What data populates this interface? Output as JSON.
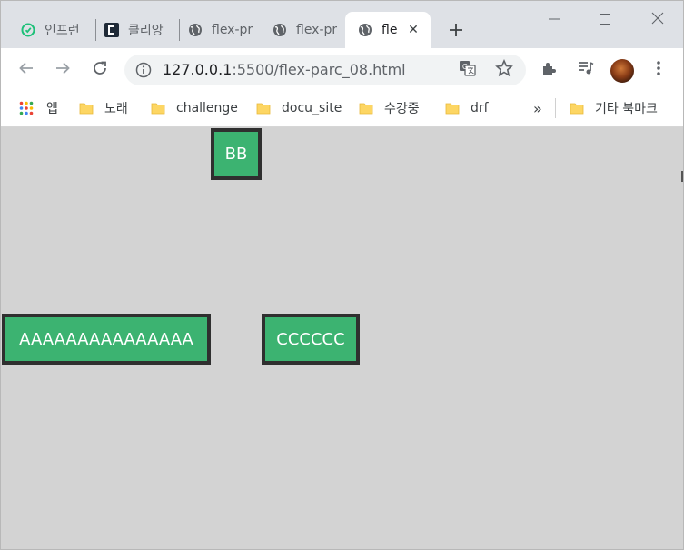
{
  "browser": {
    "tabs": [
      {
        "title": "인프런",
        "favicon": "inflearn-icon",
        "color": "#1dc078"
      },
      {
        "title": "클리앙",
        "favicon": "clien-icon",
        "color": "#1f2a37"
      },
      {
        "title": "flex-pr",
        "favicon": "globe-icon",
        "color": "#5f6368"
      },
      {
        "title": "flex-pr",
        "favicon": "globe-icon",
        "color": "#5f6368"
      },
      {
        "title": "fle",
        "favicon": "globe-icon",
        "color": "#5f6368",
        "active": true
      }
    ],
    "new_tab_icon": "plus-icon",
    "window_controls": [
      "minimize-icon",
      "maximize-icon",
      "close-icon"
    ]
  },
  "toolbar": {
    "url_host": "127.0.0.1",
    "url_path": ":5500/flex-parc_08.html",
    "buttons": [
      "back-icon",
      "forward-icon",
      "reload-icon",
      "info-icon",
      "translate-icon",
      "star-icon",
      "extensions-icon",
      "media-icon",
      "avatar",
      "menu-icon"
    ]
  },
  "bookmarks": {
    "apps_label": "앱",
    "items": [
      "노래",
      "challenge",
      "docu_site",
      "수강중",
      "drf"
    ],
    "overflow_label": "»",
    "other_label": "기타 북마크"
  },
  "page": {
    "background": "#d3d3d3",
    "item_color": "#3cb371",
    "item_border_color": "#2f2f2f",
    "boxes": {
      "a": "AAAAAAAAAAAAAAA",
      "b": "BB",
      "c": "CCCCCC"
    }
  }
}
